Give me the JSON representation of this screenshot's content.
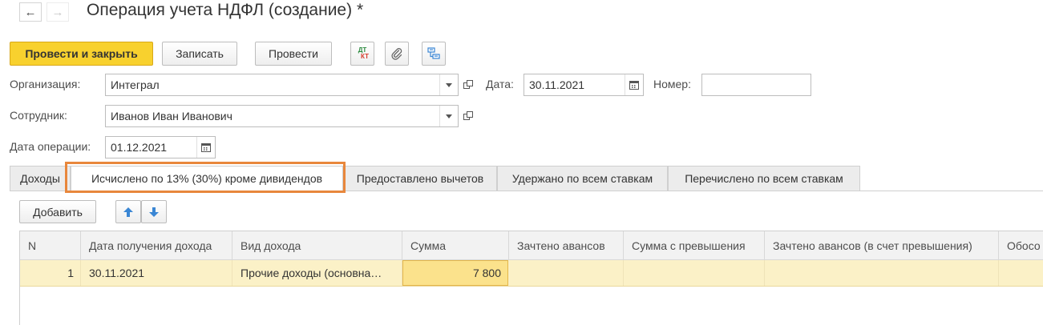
{
  "window": {
    "title": "Операция учета НДФЛ (создание) *"
  },
  "toolbar": {
    "post_close_label": "Провести и закрыть",
    "save_label": "Записать",
    "post_label": "Провести",
    "dt_kt_top": "ДТ",
    "dt_kt_bottom": "КТ"
  },
  "form": {
    "organization_label": "Организация:",
    "organization_value": "Интеграл",
    "date_label": "Дата:",
    "date_value": "30.11.2021",
    "number_label": "Номер:",
    "number_value": "",
    "employee_label": "Сотрудник:",
    "employee_value": "Иванов Иван Иванович",
    "operation_date_label": "Дата операции:",
    "operation_date_value": "01.12.2021"
  },
  "tabs": [
    {
      "label": "Доходы"
    },
    {
      "label": "Исчислено по 13% (30%) кроме дивидендов"
    },
    {
      "label": "Предоставлено вычетов"
    },
    {
      "label": "Удержано по всем ставкам"
    },
    {
      "label": "Перечислено по всем ставкам"
    }
  ],
  "table_toolbar": {
    "add_label": "Добавить"
  },
  "table": {
    "columns": [
      "N",
      "Дата получения дохода",
      "Вид дохода",
      "Сумма",
      "Зачтено авансов",
      "Сумма с превышения",
      "Зачтено авансов (в счет превышения)",
      "Обосо"
    ],
    "rows": [
      {
        "n": "1",
        "date": "30.11.2021",
        "income_type": "Прочие доходы (основна…",
        "sum": "7 800",
        "advances": "",
        "excess_sum": "",
        "advances_excess": "",
        "separate": ""
      }
    ]
  },
  "colors": {
    "primary_button": "#f8d12e",
    "tab_highlight": "#e8873c",
    "selected_row": "#fbf1c7",
    "current_cell": "#fbe28c",
    "arrow_blue": "#3a86d4"
  }
}
